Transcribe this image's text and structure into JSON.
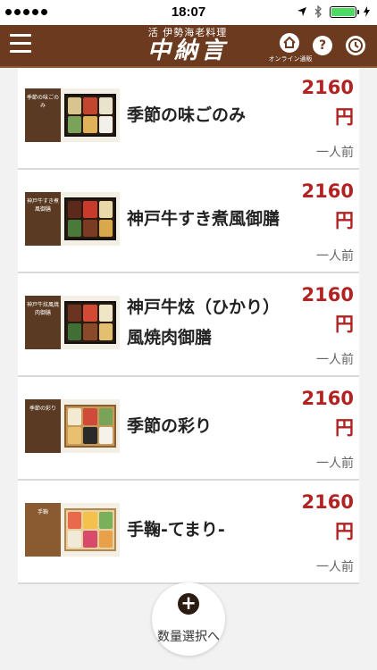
{
  "status_bar": {
    "time": "18:07"
  },
  "header": {
    "logo_sub": "活 伊勢海老料理",
    "logo_main": "中納言",
    "home_label": "オンライン通販"
  },
  "products": [
    {
      "name": "季節の味ごのみ",
      "price": "2160",
      "unit": "円",
      "serving": "一人前",
      "thumb_title": "季節の味ごのみ"
    },
    {
      "name": "神戸牛すき煮風御膳",
      "price": "2160",
      "unit": "円",
      "serving": "一人前",
      "thumb_title": "神戸牛すき煮風御膳"
    },
    {
      "name": "神戸牛炫（ひかり）風焼肉御膳",
      "price": "2160",
      "unit": "円",
      "serving": "一人前",
      "thumb_title": "神戸牛炫風焼肉御膳"
    },
    {
      "name": "季節の彩り",
      "price": "2160",
      "unit": "円",
      "serving": "一人前",
      "thumb_title": "季節の彩り"
    },
    {
      "name": "手鞠-てまり-",
      "price": "2160",
      "unit": "円",
      "serving": "一人前",
      "thumb_title": "手鞠"
    }
  ],
  "fab": {
    "label": "数量選択へ"
  },
  "colors": {
    "header_bg": "#6b3a1f",
    "price": "#b22222",
    "battery": "#4cd964"
  }
}
